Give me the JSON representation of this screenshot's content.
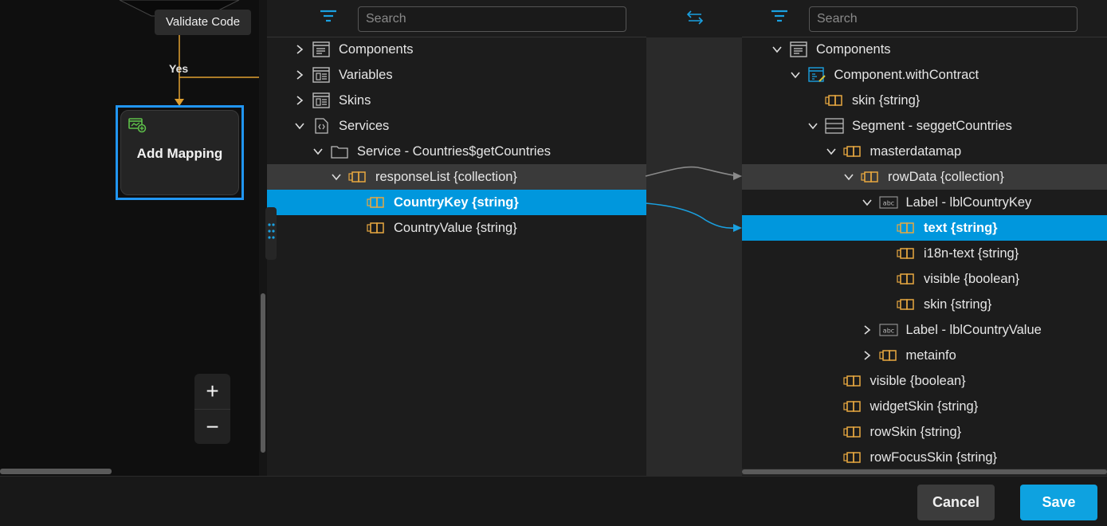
{
  "canvas": {
    "tooltip": "Validate Code",
    "yes_label": "Yes",
    "node_title": "Add Mapping",
    "zoom_in": "+",
    "zoom_out": "−"
  },
  "source": {
    "search_placeholder": "Search",
    "rows": [
      {
        "label": "Components",
        "indent": 0,
        "chevron": "right",
        "icon": "components-icon"
      },
      {
        "label": "Variables",
        "indent": 0,
        "chevron": "right",
        "icon": "variables-icon"
      },
      {
        "label": "Skins",
        "indent": 0,
        "chevron": "right",
        "icon": "skins-icon"
      },
      {
        "label": "Services",
        "indent": 0,
        "chevron": "down",
        "icon": "services-icon"
      },
      {
        "label": "Service - Countries$getCountries",
        "indent": 1,
        "chevron": "down",
        "icon": "folder-icon"
      },
      {
        "label": "responseList {collection}",
        "indent": 2,
        "chevron": "down",
        "icon": "field-icon",
        "state": "hl"
      },
      {
        "label": "CountryKey {string}",
        "indent": 3,
        "chevron": "none",
        "icon": "field-icon",
        "state": "sel"
      },
      {
        "label": "CountryValue {string}",
        "indent": 3,
        "chevron": "none",
        "icon": "field-icon"
      }
    ]
  },
  "target": {
    "search_placeholder": "Search",
    "rows": [
      {
        "label": "Components",
        "indent": 0,
        "chevron": "down",
        "icon": "components-icon"
      },
      {
        "label": "Component.withContract",
        "indent": 1,
        "chevron": "down",
        "icon": "contract-icon"
      },
      {
        "label": "skin {string}",
        "indent": 2,
        "chevron": "none",
        "icon": "field-icon"
      },
      {
        "label": "Segment - seggetCountries",
        "indent": 2,
        "chevron": "down",
        "icon": "segment-icon"
      },
      {
        "label": "masterdatamap",
        "indent": 3,
        "chevron": "down",
        "icon": "field-icon"
      },
      {
        "label": "rowData {collection}",
        "indent": 4,
        "chevron": "down",
        "icon": "field-icon",
        "state": "hl"
      },
      {
        "label": "Label - lblCountryKey",
        "indent": 5,
        "chevron": "down",
        "icon": "label-icon"
      },
      {
        "label": "text {string}",
        "indent": 6,
        "chevron": "none",
        "icon": "field-icon",
        "state": "sel"
      },
      {
        "label": "i18n-text {string}",
        "indent": 6,
        "chevron": "none",
        "icon": "field-icon"
      },
      {
        "label": "visible {boolean}",
        "indent": 6,
        "chevron": "none",
        "icon": "field-icon"
      },
      {
        "label": "skin {string}",
        "indent": 6,
        "chevron": "none",
        "icon": "field-icon"
      },
      {
        "label": "Label - lblCountryValue",
        "indent": 5,
        "chevron": "right",
        "icon": "label-icon"
      },
      {
        "label": "metainfo",
        "indent": 5,
        "chevron": "right",
        "icon": "field-icon"
      },
      {
        "label": "visible {boolean}",
        "indent": 3,
        "chevron": "none",
        "icon": "field-icon"
      },
      {
        "label": "widgetSkin {string}",
        "indent": 3,
        "chevron": "none",
        "icon": "field-icon"
      },
      {
        "label": "rowSkin {string}",
        "indent": 3,
        "chevron": "none",
        "icon": "field-icon"
      },
      {
        "label": "rowFocusSkin {string}",
        "indent": 3,
        "chevron": "none",
        "icon": "field-icon"
      }
    ]
  },
  "footer": {
    "cancel_label": "Cancel",
    "save_label": "Save"
  },
  "colors": {
    "accent": "#0097dd",
    "node_border": "#2196f3",
    "flow_line": "#e0a030",
    "field_icon": "#e8a840",
    "mapped_line": "#1aa0e0",
    "unmapped_line": "#8a8a8a"
  }
}
